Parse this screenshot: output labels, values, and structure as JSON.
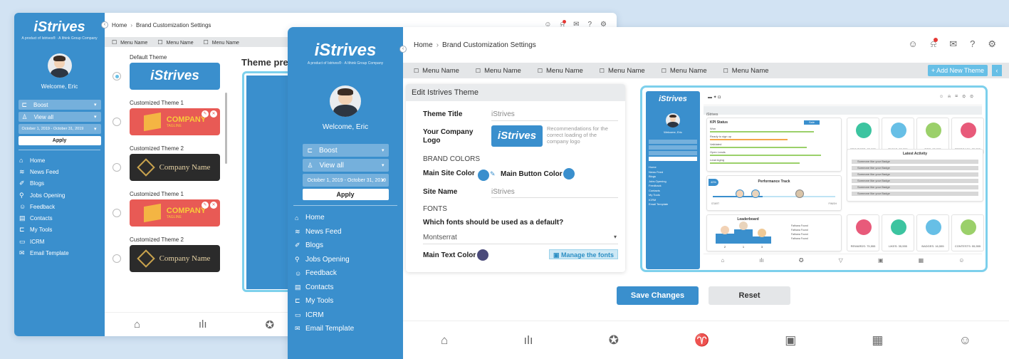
{
  "app": {
    "logo": "Strives",
    "logo_mark": "i",
    "tagline": "A product of Istrives® · A Ithink Group Company"
  },
  "user": {
    "welcome": "Welcome, Eric"
  },
  "filters": {
    "group": "Boost",
    "view": "View all",
    "date_range": "October 1, 2019 - October 31, 2019",
    "apply": "Apply"
  },
  "nav": [
    {
      "label": "Home",
      "icon": "home-icon"
    },
    {
      "label": "News Feed",
      "icon": "news-icon"
    },
    {
      "label": "Blogs",
      "icon": "blog-icon"
    },
    {
      "label": "Jobs Opening",
      "icon": "jobs-icon"
    },
    {
      "label": "Feedback",
      "icon": "feedback-icon"
    },
    {
      "label": "Contacts",
      "icon": "contacts-icon"
    },
    {
      "label": "My Tools",
      "icon": "tools-icon"
    },
    {
      "label": "ICRM",
      "icon": "crm-icon"
    },
    {
      "label": "Email Template",
      "icon": "email-icon"
    }
  ],
  "breadcrumb": {
    "home": "Home",
    "sep": "›",
    "current": "Brand Customization Settings"
  },
  "menu": [
    "Menu Name",
    "Menu Name",
    "Menu Name",
    "Menu Name",
    "Menu Name",
    "Menu Name"
  ],
  "add_new_theme": "+ Add New Theme",
  "themes": [
    {
      "title": "Default Theme",
      "style": "blue",
      "selected": true
    },
    {
      "title": "Customized Theme 1",
      "style": "red",
      "selected": false
    },
    {
      "title": "Customized Theme 2",
      "style": "dark",
      "selected": false
    },
    {
      "title": "Customized Theme 1",
      "style": "red",
      "selected": false
    },
    {
      "title": "Customized Theme 2",
      "style": "dark",
      "selected": false
    }
  ],
  "theme_cards": {
    "company": "COMPANY",
    "company_sub": "TAGLINE",
    "company_name": "Company Name"
  },
  "preview_title": "Theme prev",
  "edit": {
    "header": "Edit Istrives Theme",
    "theme_title_label": "Theme Title",
    "theme_title_value": "iStrives",
    "logo_label": "Your Company Logo",
    "logo_hint": "Recommendations for the correct loading of the company logo",
    "brand_colors": "BRAND COLORS",
    "main_site_color_label": "Main Site Color",
    "main_button_color_label": "Main Button  Color",
    "site_name_label": "Site Name",
    "site_name_value": "iStrives",
    "fonts_heading": "FONTS",
    "fonts_question": "Which fonts should be used as a default?",
    "font_value": "Montserrat",
    "main_text_color_label": "Main Text  Color",
    "manage_fonts": "Manage the fonts",
    "main_site_color": "#3a8fcd",
    "main_button_color": "#3a8fcd",
    "main_text_color": "#4a4a7a"
  },
  "preview": {
    "subtitle": "iStrives",
    "kpi_title": "KPI Status",
    "kpi_rows": [
      "Won",
      "Ready to sign up",
      "Validated",
      "Open Leads",
      "Lead Aging"
    ],
    "kpi_badge": "Sale",
    "performance_title": "Performance Track",
    "perf_pct": "40%",
    "perf_start": "START",
    "perf_finish": "FINISH",
    "leaderboard_title": "Leaderboard",
    "leaderboard_ranks": [
      "2",
      "1",
      "3"
    ],
    "leaderboard_names": [
      "Fathana Found",
      "Fathana Found",
      "Fathana Found",
      "Fathana Found"
    ],
    "activity_title": "Latest Activity",
    "activity_items": [
      "Someone like your Badge",
      "Someone like your Badge",
      "Someone like your Badge",
      "Someone like your Badge",
      "Someone like your Badge",
      "Someone like your Badge"
    ],
    "stats_top": [
      "PROJECTS: 35,555",
      "TASKS: 35,555",
      "TIPS: 35,555",
      "FEEDBACK: 35,555"
    ],
    "stats_bottom": [
      "REWARDS: 75,555",
      "LIKES: 35,555",
      "BADGES: 16,555",
      "CONTESTS: 55,555"
    ],
    "stat_colors_top": [
      "#3cc4a0",
      "#67bfe6",
      "#9bd06a",
      "#e85a7a"
    ],
    "stat_colors_bottom": [
      "#e85a7a",
      "#3cc4a0",
      "#67bfe6",
      "#9bd06a"
    ]
  },
  "actions": {
    "save": "Save Changes",
    "reset": "Reset"
  }
}
